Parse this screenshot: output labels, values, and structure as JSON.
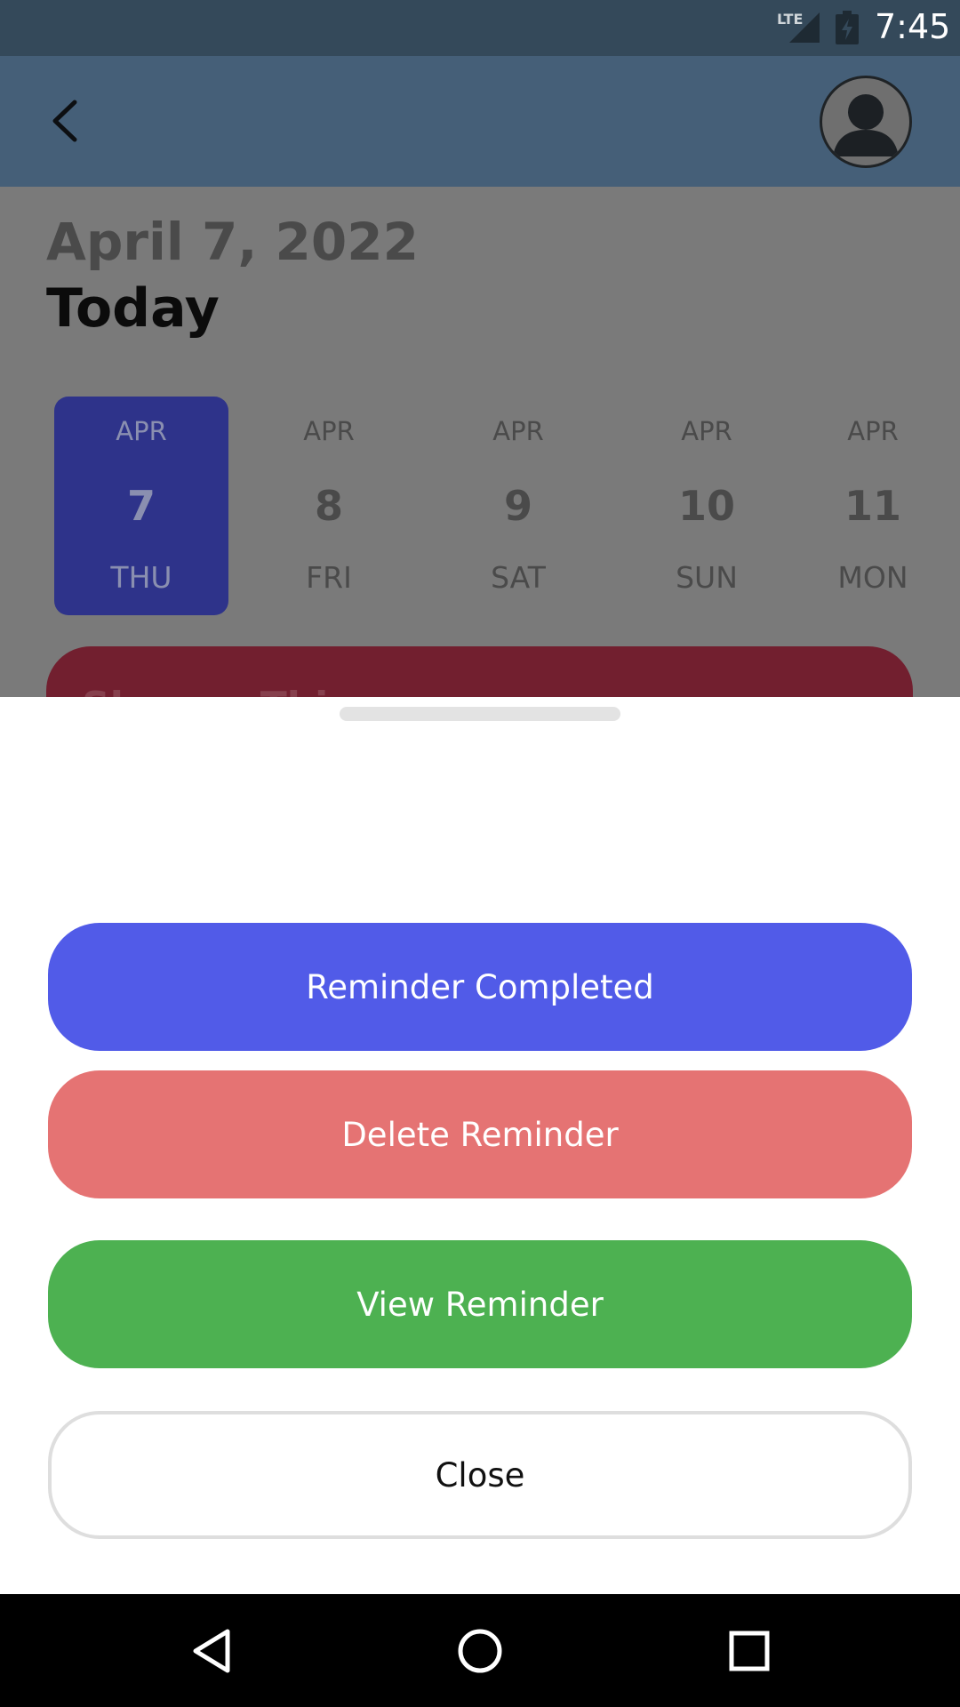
{
  "status_bar": {
    "network": "LTE",
    "time": "7:45"
  },
  "header": {
    "back_icon": "arrow-back-icon",
    "avatar_icon": "user-avatar-icon"
  },
  "content": {
    "date": "April 7, 2022",
    "today_label": "Today",
    "days": [
      {
        "month": "APR",
        "day": "7",
        "weekday": "THU",
        "selected": true
      },
      {
        "month": "APR",
        "day": "8",
        "weekday": "FRI",
        "selected": false
      },
      {
        "month": "APR",
        "day": "9",
        "weekday": "SAT",
        "selected": false
      },
      {
        "month": "APR",
        "day": "10",
        "weekday": "SUN",
        "selected": false
      },
      {
        "month": "APR",
        "day": "11",
        "weekday": "MON",
        "selected": false
      }
    ],
    "event_partial_title": "Shower Thi"
  },
  "sheet": {
    "actions": {
      "complete_label": "Reminder Completed",
      "delete_label": "Delete Reminder",
      "view_label": "View Reminder",
      "close_label": "Close"
    }
  },
  "nav_bar": {
    "back": "nav-back-icon",
    "home": "nav-home-icon",
    "recents": "nav-recents-icon"
  },
  "colors": {
    "complete": "#515be8",
    "delete": "#e57373",
    "view": "#4db151",
    "selected_day": "#2e338a",
    "event_card": "#721f2f"
  }
}
